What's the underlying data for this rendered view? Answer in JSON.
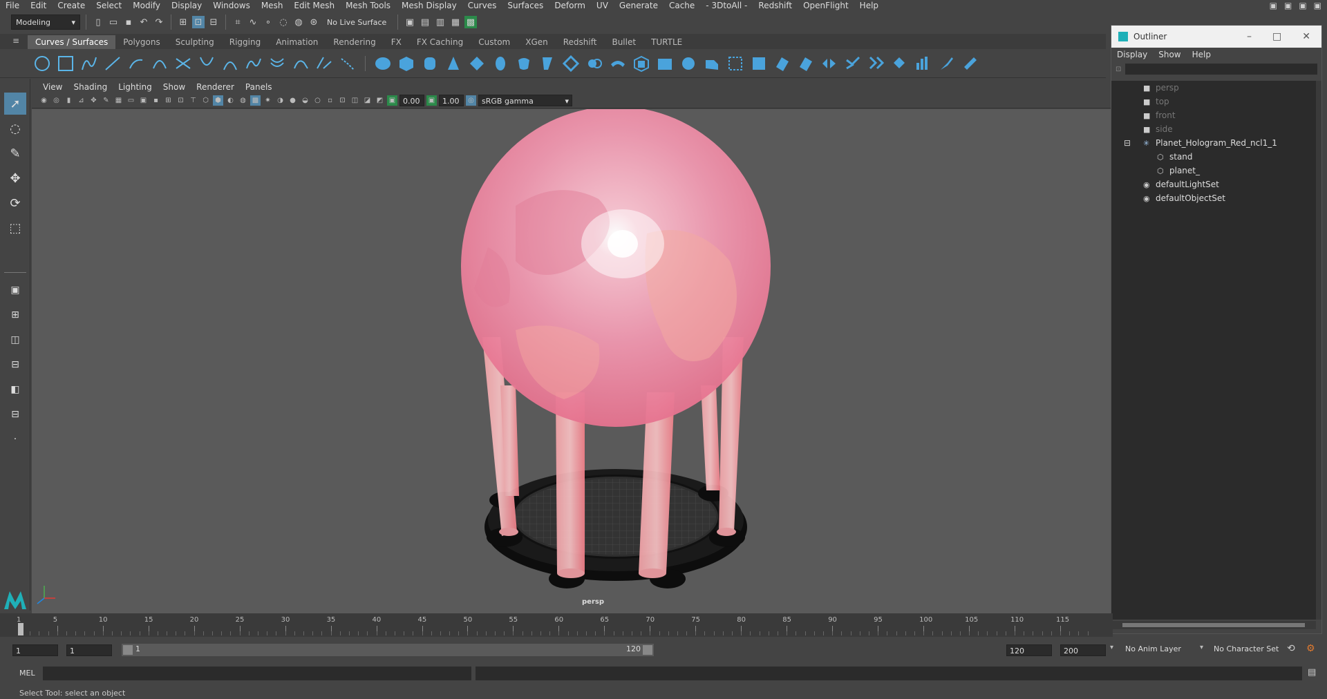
{
  "menubar": {
    "items": [
      "File",
      "Edit",
      "Create",
      "Select",
      "Modify",
      "Display",
      "Windows",
      "Mesh",
      "Edit Mesh",
      "Mesh Tools",
      "Mesh Display",
      "Curves",
      "Surfaces",
      "Deform",
      "UV",
      "Generate",
      "Cache",
      "- 3DtoAll -",
      "Redshift",
      "OpenFlight",
      "Help"
    ]
  },
  "statusline": {
    "workspace": "Modeling",
    "live_surface": "No Live Surface"
  },
  "shelf": {
    "tabs": [
      "Curves / Surfaces",
      "Polygons",
      "Sculpting",
      "Rigging",
      "Animation",
      "Rendering",
      "FX",
      "FX Caching",
      "Custom",
      "XGen",
      "Redshift",
      "Bullet",
      "TURTLE"
    ],
    "active_tab": "Curves / Surfaces"
  },
  "panel": {
    "menu": [
      "View",
      "Shading",
      "Lighting",
      "Show",
      "Renderer",
      "Panels"
    ],
    "exposure": "0.00",
    "gamma": "1.00",
    "colorspace": "sRGB gamma",
    "camera_label": "persp"
  },
  "outliner": {
    "title": "Outliner",
    "menu": [
      "Display",
      "Show",
      "Help"
    ],
    "items": [
      {
        "label": "persp",
        "icon": "camera-icon",
        "indent": 0,
        "dim": true
      },
      {
        "label": "top",
        "icon": "camera-icon",
        "indent": 0,
        "dim": true
      },
      {
        "label": "front",
        "icon": "camera-icon",
        "indent": 0,
        "dim": true
      },
      {
        "label": "side",
        "icon": "camera-icon",
        "indent": 0,
        "dim": true
      },
      {
        "label": "Planet_Hologram_Red_ncl1_1",
        "icon": "group-icon",
        "indent": 0,
        "dim": false
      },
      {
        "label": "stand",
        "icon": "mesh-icon",
        "indent": 1,
        "dim": false
      },
      {
        "label": "planet_",
        "icon": "mesh-icon",
        "indent": 1,
        "dim": false
      },
      {
        "label": "defaultLightSet",
        "icon": "set-icon",
        "indent": 0,
        "dim": false
      },
      {
        "label": "defaultObjectSet",
        "icon": "set-icon",
        "indent": 0,
        "dim": false
      }
    ]
  },
  "timeline": {
    "ticks": [
      "1",
      "5",
      "10",
      "15",
      "20",
      "25",
      "30",
      "35",
      "40",
      "45",
      "50",
      "55",
      "60",
      "65",
      "70",
      "75",
      "80",
      "85",
      "90",
      "95",
      "100",
      "105",
      "110",
      "115"
    ],
    "current_frame": "1"
  },
  "range": {
    "start": "1",
    "playback_start": "1",
    "slider_start": "1",
    "slider_end": "120",
    "playback_end": "120",
    "end": "200",
    "anim_layer": "No Anim Layer",
    "character_set": "No Character Set"
  },
  "command": {
    "label": "MEL"
  },
  "help": {
    "text": "Select Tool: select an object"
  },
  "colors": {
    "accent": "#5285a6",
    "planet": "#f08aa0",
    "stand": "#111111"
  }
}
